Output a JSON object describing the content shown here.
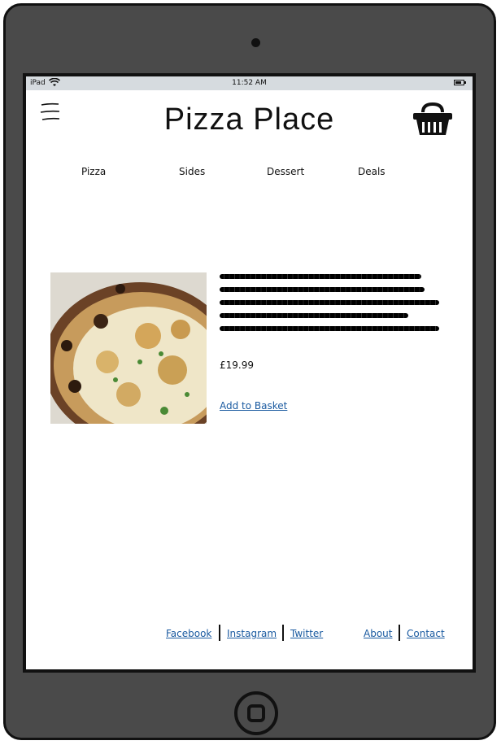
{
  "status_bar": {
    "carrier": "iPad",
    "time": "11:52 AM"
  },
  "header": {
    "title": "Pizza Place",
    "menu_icon": "hamburger-menu-icon",
    "basket_icon": "basket-icon"
  },
  "nav": {
    "items": [
      {
        "label": "Pizza"
      },
      {
        "label": "Sides"
      },
      {
        "label": "Dessert"
      },
      {
        "label": "Deals"
      }
    ]
  },
  "product": {
    "image": "pizza-photo",
    "description_icon": "scribbled-text",
    "price": "£19.99",
    "add_to_basket": "Add to Basket"
  },
  "footer": {
    "social": [
      {
        "label": "Facebook"
      },
      {
        "label": "Instagram"
      },
      {
        "label": "Twitter"
      }
    ],
    "info": [
      {
        "label": "About"
      },
      {
        "label": "Contact"
      }
    ]
  }
}
